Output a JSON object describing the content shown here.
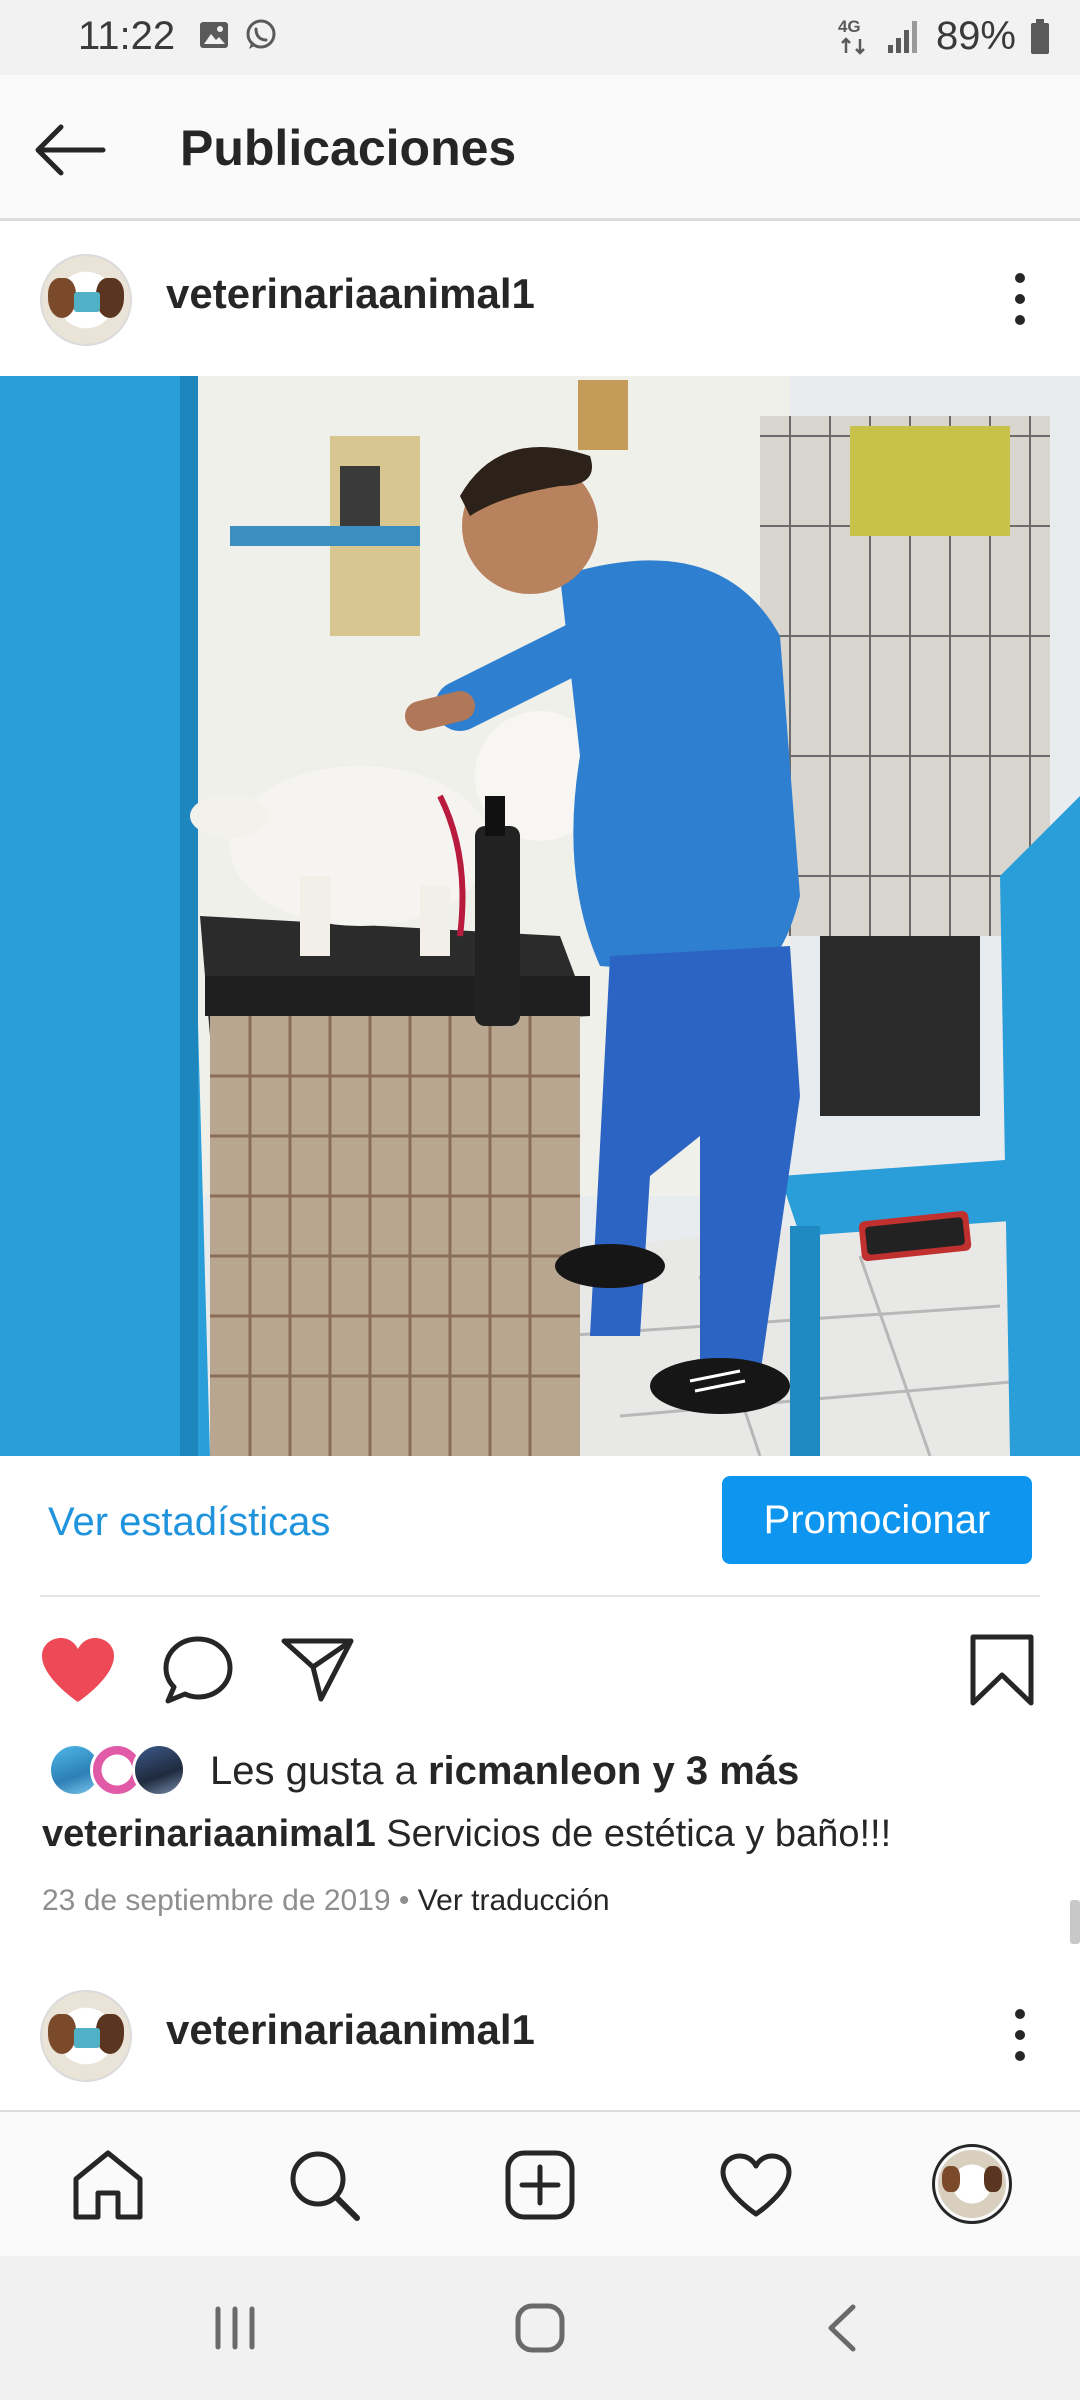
{
  "status_bar": {
    "time": "11:22",
    "network": "4G",
    "battery": "89%",
    "icons": [
      "image-icon",
      "whatsapp-icon",
      "signal-icon",
      "battery-icon"
    ]
  },
  "header": {
    "title": "Publicaciones",
    "back_icon": "back-arrow-icon"
  },
  "post": {
    "username": "veterinariaanimal1",
    "image_alt": "veterinarian grooming white dog",
    "insights_label": "Ver estadísticas",
    "promote_label": "Promocionar",
    "actions": [
      "heart-icon",
      "comment-icon",
      "share-icon",
      "bookmark-icon"
    ],
    "liked": true,
    "likes_prefix": "Les gusta a ",
    "likes_user": "ricmanleon",
    "likes_connector": " y ",
    "likes_others": "3 más",
    "caption_user": "veterinariaanimal1",
    "caption_text": " Servicios de estética y baño!!!",
    "date": "23 de septiembre de 2019",
    "separator": " • ",
    "translate_label": "Ver traducción"
  },
  "next_post": {
    "username": "veterinariaanimal1"
  },
  "bottom_nav": [
    "home-icon",
    "search-icon",
    "add-post-icon",
    "activity-icon",
    "profile-avatar"
  ],
  "colors": {
    "accent": "#0d95f0",
    "link": "#1f94dc",
    "like": "#ed4956",
    "text": "#262626",
    "muted": "#8e8e8e"
  }
}
